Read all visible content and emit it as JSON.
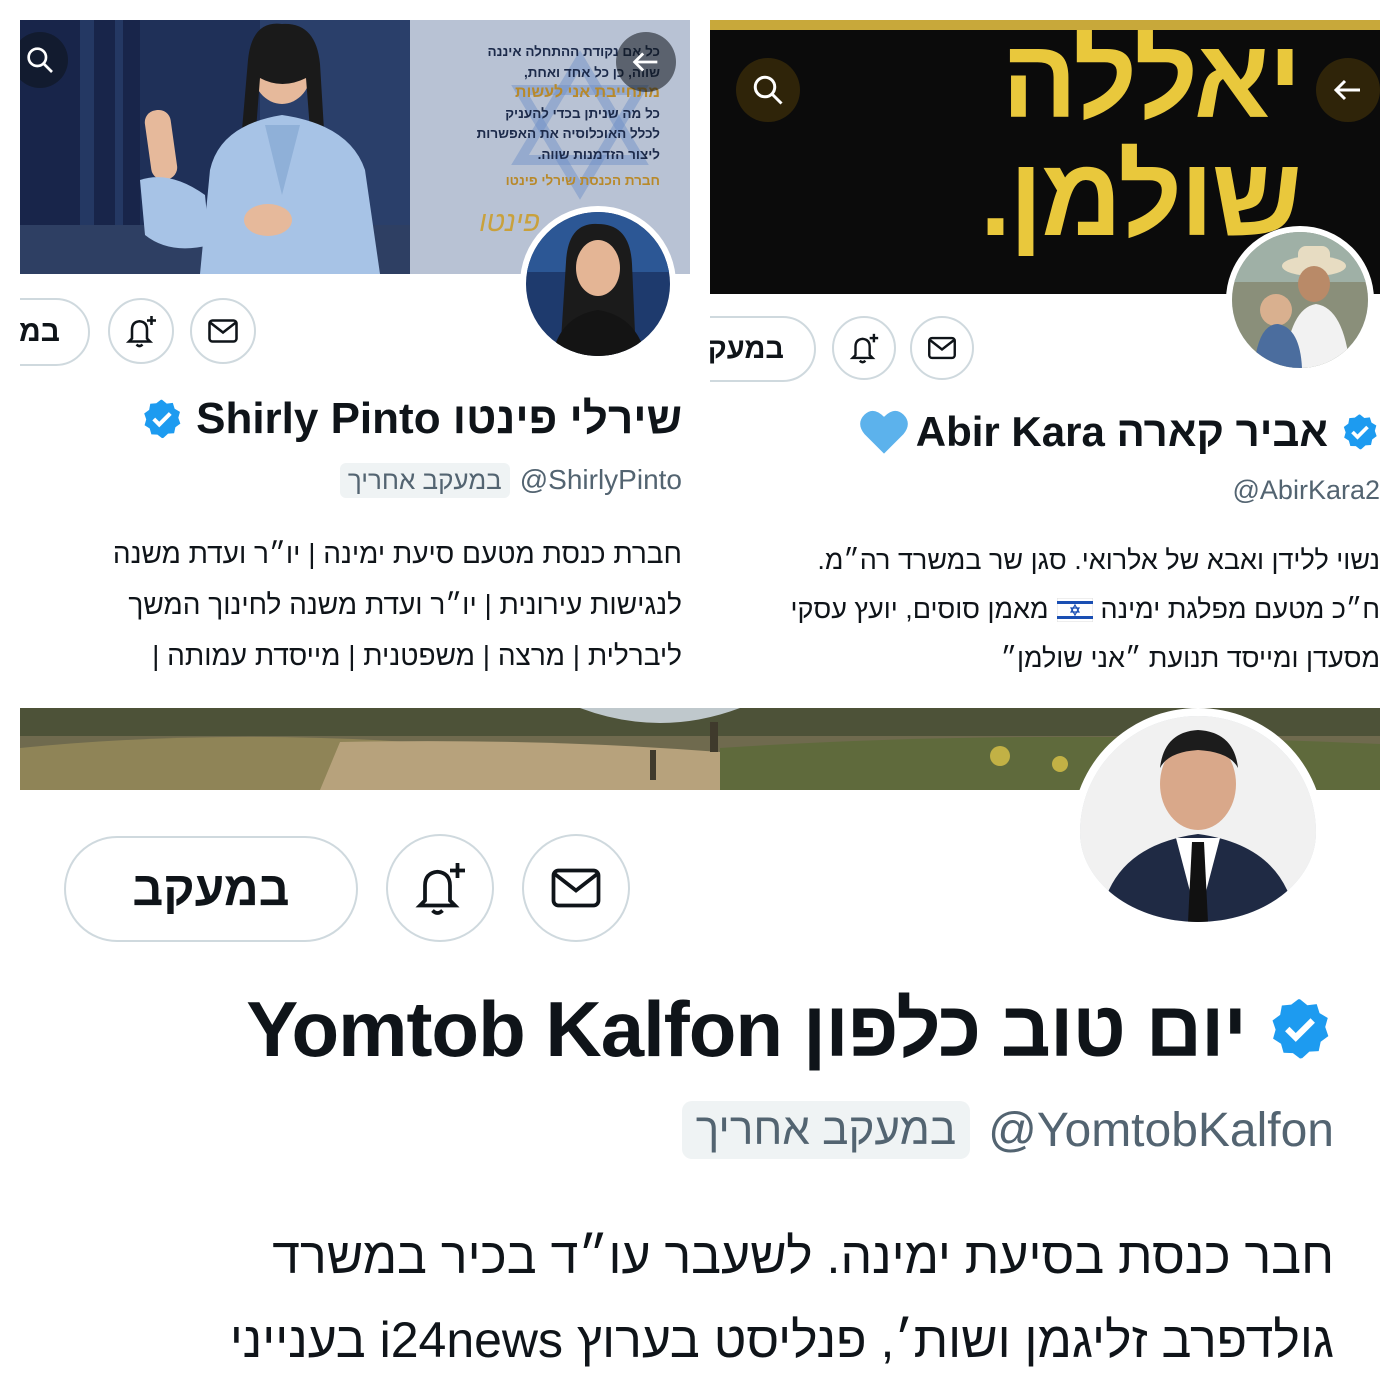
{
  "colors": {
    "verified": "#1d9bf0",
    "border": "#cfd9de",
    "secondary_text": "#536471",
    "heart": "#5cb2ec",
    "banner_yellow": "#e9c83c"
  },
  "icons": {
    "search": "search-icon",
    "back": "arrow-left-icon",
    "notify": "bell-plus-icon",
    "message": "envelope-icon",
    "verified": "verified-badge-icon",
    "heart": "blue-heart-icon",
    "flag": "israel-flag-icon"
  },
  "profiles": {
    "pinto": {
      "name": "שירלי פינטו Shirly Pinto",
      "handle": "@ShirlyPinto",
      "follows_you": "במעקב אחריך",
      "follow_label": "במעקב",
      "bio_lines": [
        "חברת כנסת מטעם סיעת ימינה | יו״ר ועדת משנה",
        "לנגישות עירונית | יו״ר ועדת משנה לחינוך המשך",
        "ליברלית | מרצה | משפטנית | מייסדת עמותה |"
      ],
      "banner_lines": [
        "כל אם נקודת ההתחלה איננה",
        "שווה, כן כל אחד ואחת,",
        "מתחייבת אני לעשות",
        "כל מה שניתן בכדי להעניק",
        "לכלל האוכלוסיה את האפשרות",
        "ליצור הזדמנות שווה.",
        "חברת הכנסת שירלי פינטו"
      ],
      "banner_signature": "פינטו"
    },
    "kara": {
      "name": "אביר קארה Abir Kara",
      "handle": "@AbirKara2",
      "follow_label": "במעקב",
      "banner_lines": [
        "יאללה",
        "שולמן."
      ],
      "bio_lines": [
        "נשוי ללידן ואבא של אלרואי. סגן שר במשרד רה״מ.",
        "ח״כ מטעם מפלגת ימינה",
        "מאמן סוסים, יועץ עסקי",
        "מסעדן ומייסד תנועת ״אני שולמן״"
      ]
    },
    "kalfon": {
      "name": "יום טוב כלפון Yomtob Kalfon",
      "handle": "@YomtobKalfon",
      "follows_you": "במעקב אחריך",
      "follow_label": "במעקב",
      "bio_lines": [
        "חבר כנסת בסיעת ימינה. לשעבר עו״ד בכיר במשרד",
        "גולדפרב זליגמן ושות׳, פנליסט בערוץ i24news בענייני"
      ]
    }
  }
}
